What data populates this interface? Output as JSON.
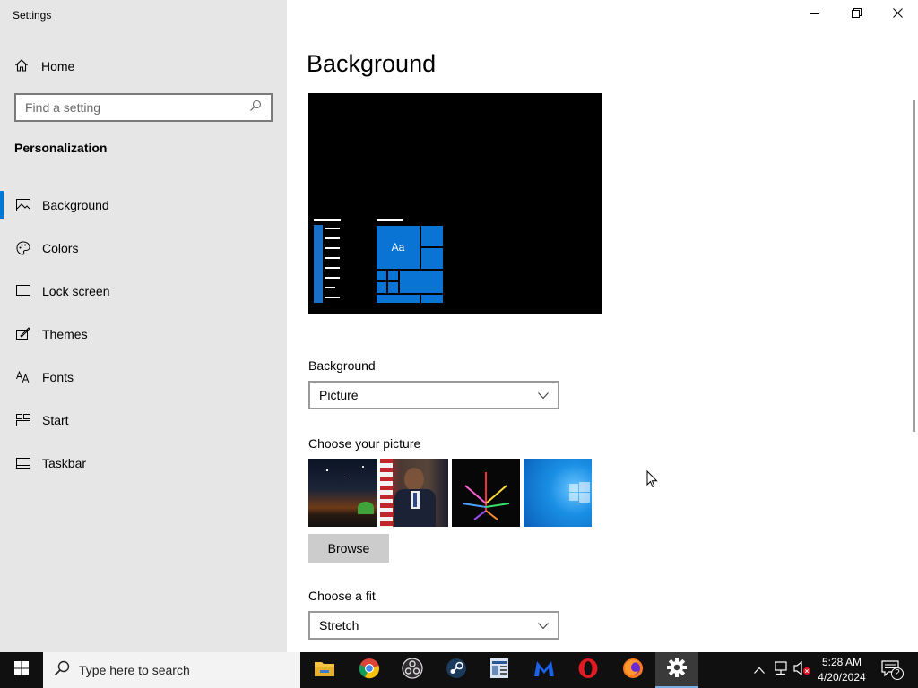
{
  "window": {
    "title": "Settings",
    "controls": [
      "minimize",
      "restore",
      "close"
    ]
  },
  "sidebar": {
    "home_label": "Home",
    "search_placeholder": "Find a setting",
    "section_title": "Personalization",
    "items": [
      {
        "label": "Background",
        "icon": "picture-icon",
        "active": true
      },
      {
        "label": "Colors",
        "icon": "palette-icon",
        "active": false
      },
      {
        "label": "Lock screen",
        "icon": "lock-screen-icon",
        "active": false
      },
      {
        "label": "Themes",
        "icon": "themes-icon",
        "active": false
      },
      {
        "label": "Fonts",
        "icon": "fonts-icon",
        "active": false
      },
      {
        "label": "Start",
        "icon": "start-icon",
        "active": false
      },
      {
        "label": "Taskbar",
        "icon": "taskbar-icon",
        "active": false
      }
    ]
  },
  "main": {
    "title": "Background",
    "preview": {
      "sample_text": "Aa"
    },
    "background_label": "Background",
    "background_value": "Picture",
    "choose_picture_label": "Choose your picture",
    "pictures": [
      "night-sky-tent",
      "portrait",
      "neon-leaf",
      "windows-10-blue"
    ],
    "browse_label": "Browse",
    "fit_label": "Choose a fit",
    "fit_value": "Stretch"
  },
  "taskbar": {
    "search_placeholder": "Type here to search",
    "apps": [
      "file-explorer-icon",
      "chrome-icon",
      "obs-icon",
      "steam-icon",
      "document-icon",
      "malwarebytes-icon",
      "opera-icon",
      "firefox-icon",
      "settings-icon"
    ],
    "time": "5:28 AM",
    "date": "4/20/2024",
    "notification_count": "2"
  },
  "colors": {
    "accent": "#0078d7",
    "sidebar_bg": "#e6e6e6",
    "taskbar_bg": "#101010"
  }
}
